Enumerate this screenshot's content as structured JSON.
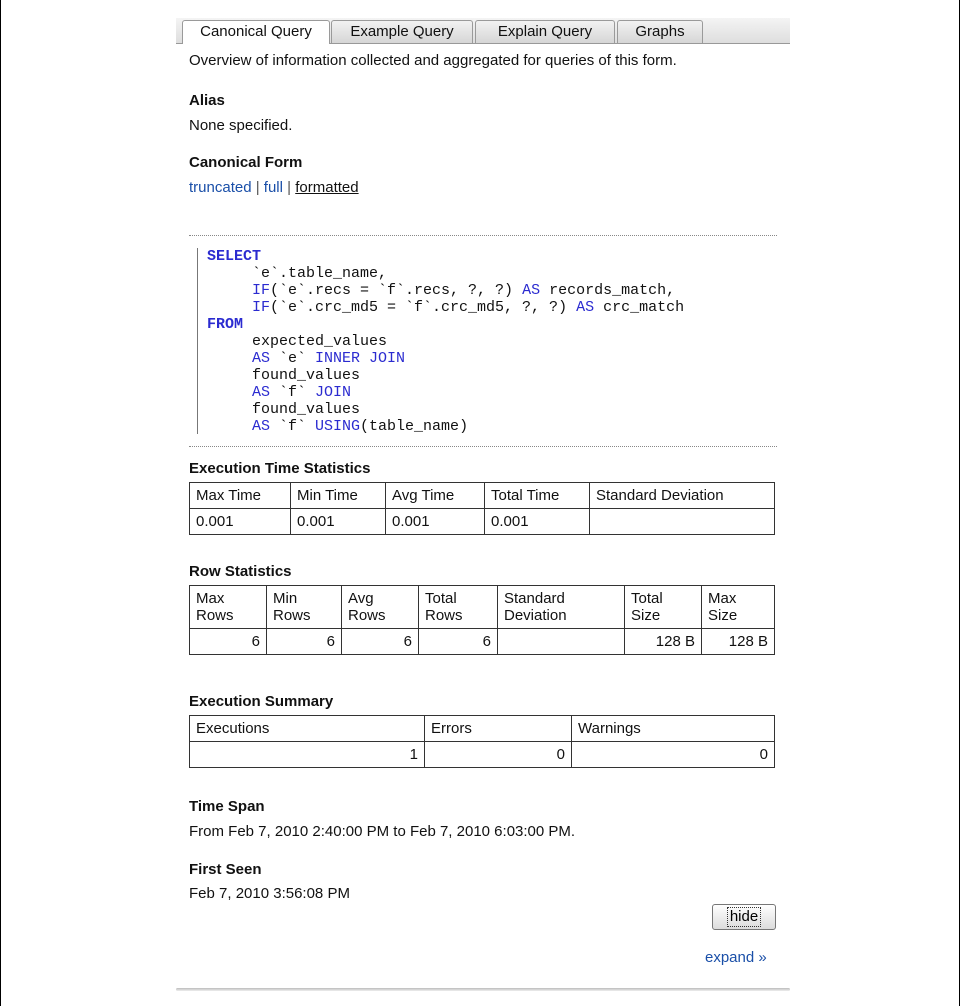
{
  "tabs": [
    {
      "label": "Canonical Query"
    },
    {
      "label": "Example Query"
    },
    {
      "label": "Explain Query"
    },
    {
      "label": "Graphs"
    }
  ],
  "overview": "Overview of information collected and aggregated for queries of this form.",
  "alias": {
    "heading": "Alias",
    "value": "None specified."
  },
  "canonical_form": {
    "heading": "Canonical Form",
    "links": {
      "truncated": "truncated",
      "full": "full",
      "formatted": "formatted",
      "separator": "|"
    }
  },
  "sql": {
    "select": "SELECT",
    "l1": "     `e`.table_name,",
    "l2_kw": "     IF",
    "l2_a": "(`e`.recs = `f`.recs, ?, ?) ",
    "l2_as": "AS",
    "l2_b": " records_match,",
    "l3_kw": "     IF",
    "l3_a": "(`e`.crc_md5 = `f`.crc_md5, ?, ?) ",
    "l3_as": "AS",
    "l3_b": " crc_match",
    "from": "FROM",
    "l5": "     expected_values",
    "l6_as": "     AS",
    "l6_a": " `e` ",
    "l6_join": "INNER JOIN",
    "l7": "     found_values",
    "l8_as": "     AS",
    "l8_a": " `f` ",
    "l8_join": "JOIN",
    "l9": "     found_values",
    "l10_as": "     AS",
    "l10_a": " `f` ",
    "l10_using": "USING",
    "l10_b": "(table_name)"
  },
  "exec_time": {
    "heading": "Execution Time Statistics",
    "headers": [
      "Max Time",
      "Min Time",
      "Avg Time",
      "Total Time",
      "Standard Deviation"
    ],
    "values": [
      "0.001",
      "0.001",
      "0.001",
      "0.001",
      ""
    ]
  },
  "row_stats": {
    "heading": "Row Statistics",
    "headers": [
      {
        "top": "Max",
        "bottom": "Rows"
      },
      {
        "top": "Min",
        "bottom": "Rows"
      },
      {
        "top": "Avg",
        "bottom": "Rows"
      },
      {
        "top": "Total",
        "bottom": "Rows"
      },
      {
        "top": "Standard",
        "bottom": "Deviation"
      },
      {
        "top": "Total",
        "bottom": "Size"
      },
      {
        "top": "Max",
        "bottom": "Size"
      }
    ],
    "values": [
      "6",
      "6",
      "6",
      "6",
      "",
      "128 B",
      "128 B"
    ]
  },
  "exec_summary": {
    "heading": "Execution Summary",
    "headers": [
      "Executions",
      "Errors",
      "Warnings"
    ],
    "values": [
      "1",
      "0",
      "0"
    ]
  },
  "time_span": {
    "heading": "Time Span",
    "value": "From Feb 7, 2010 2:40:00 PM to Feb 7, 2010 6:03:00 PM."
  },
  "first_seen": {
    "heading": "First Seen",
    "value": "Feb 7, 2010 3:56:08 PM"
  },
  "buttons": {
    "hide": "hide",
    "expand": "expand »"
  }
}
